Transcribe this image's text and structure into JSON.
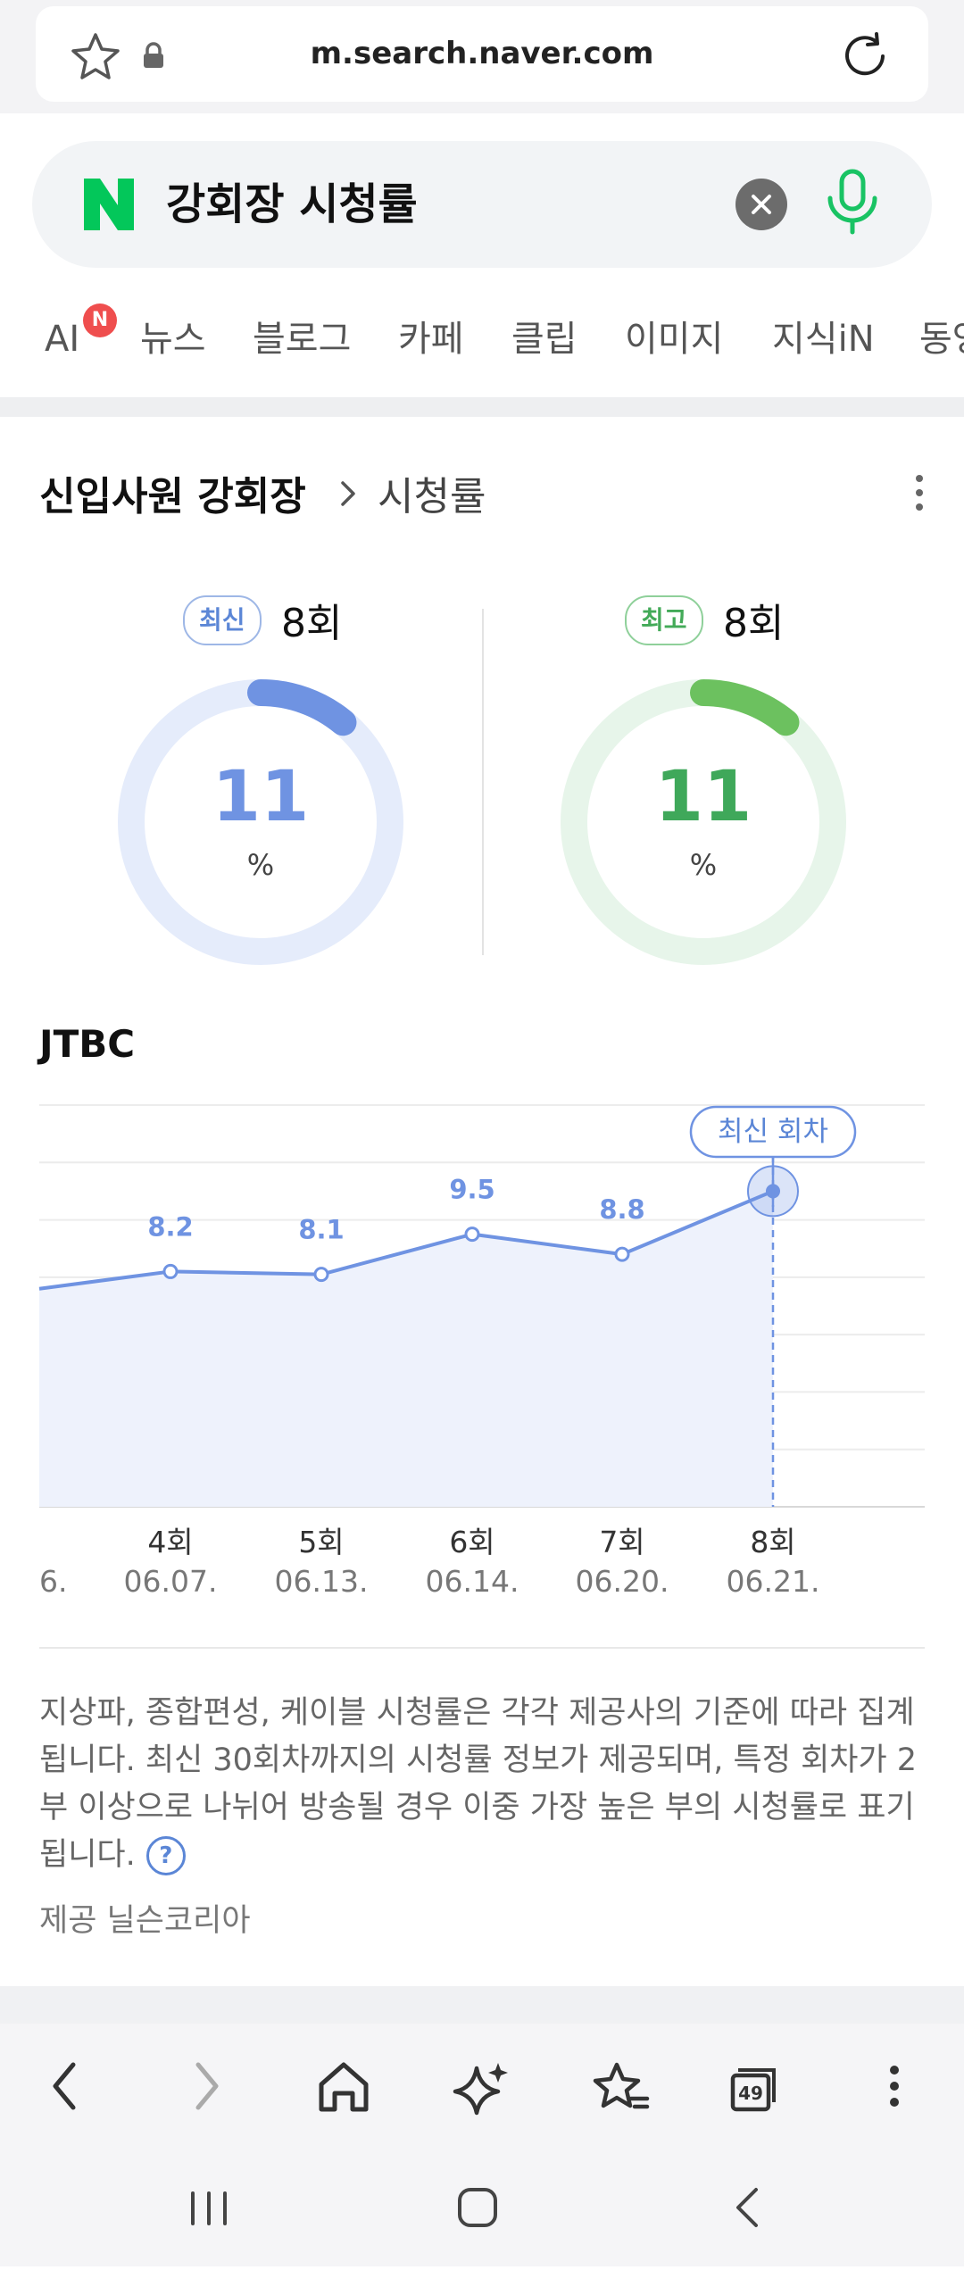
{
  "browser": {
    "url": "m.search.naver.com"
  },
  "search": {
    "query": "강회장 시청률"
  },
  "tabs": [
    {
      "label": "AI",
      "badge": "N"
    },
    {
      "label": "뉴스"
    },
    {
      "label": "블로그"
    },
    {
      "label": "카페"
    },
    {
      "label": "클립"
    },
    {
      "label": "이미지"
    },
    {
      "label": "지식iN"
    },
    {
      "label": "동영"
    }
  ],
  "section": {
    "title": "신입사원 강회장",
    "subtitle": "시청률"
  },
  "summary": {
    "latest": {
      "badge": "최신",
      "episode": "8회",
      "value": "11",
      "unit": "%",
      "fraction": 0.11,
      "color": "#6f93e2"
    },
    "best": {
      "badge": "최고",
      "episode": "8회",
      "value": "11",
      "unit": "%",
      "fraction": 0.11,
      "color": "#6cc15f"
    }
  },
  "network": "JTBC",
  "chart_data": {
    "type": "area",
    "x": [
      "6.",
      "4회",
      "5회",
      "6회",
      "7회",
      "8회"
    ],
    "dates": [
      "6.",
      "06.07.",
      "06.13.",
      "06.14.",
      "06.20.",
      "06.21."
    ],
    "values": [
      7.6,
      8.2,
      8.1,
      9.5,
      8.8,
      11.0
    ],
    "value_labels": [
      "",
      "8.2",
      "8.1",
      "9.5",
      "8.8",
      "11.0"
    ],
    "callout": "최신 회차",
    "highlight_index": 5,
    "ylim": [
      0,
      14
    ],
    "grid": true,
    "color": "#6f93e2"
  },
  "note": {
    "text": "지상파, 종합편성, 케이블 시청률은 각각 제공사의 기준에 따라 집계됩니다. 최신 30회차까지의 시청률 정보가 제공되며, 특정 회차가 2부 이상으로 나뉘어 방송될 경우 이중 가장 높은 부의 시청률로 표기됩니다.",
    "help": "?",
    "provider": "제공 닐슨코리아"
  },
  "toolbar": {
    "tab_count": "49"
  }
}
